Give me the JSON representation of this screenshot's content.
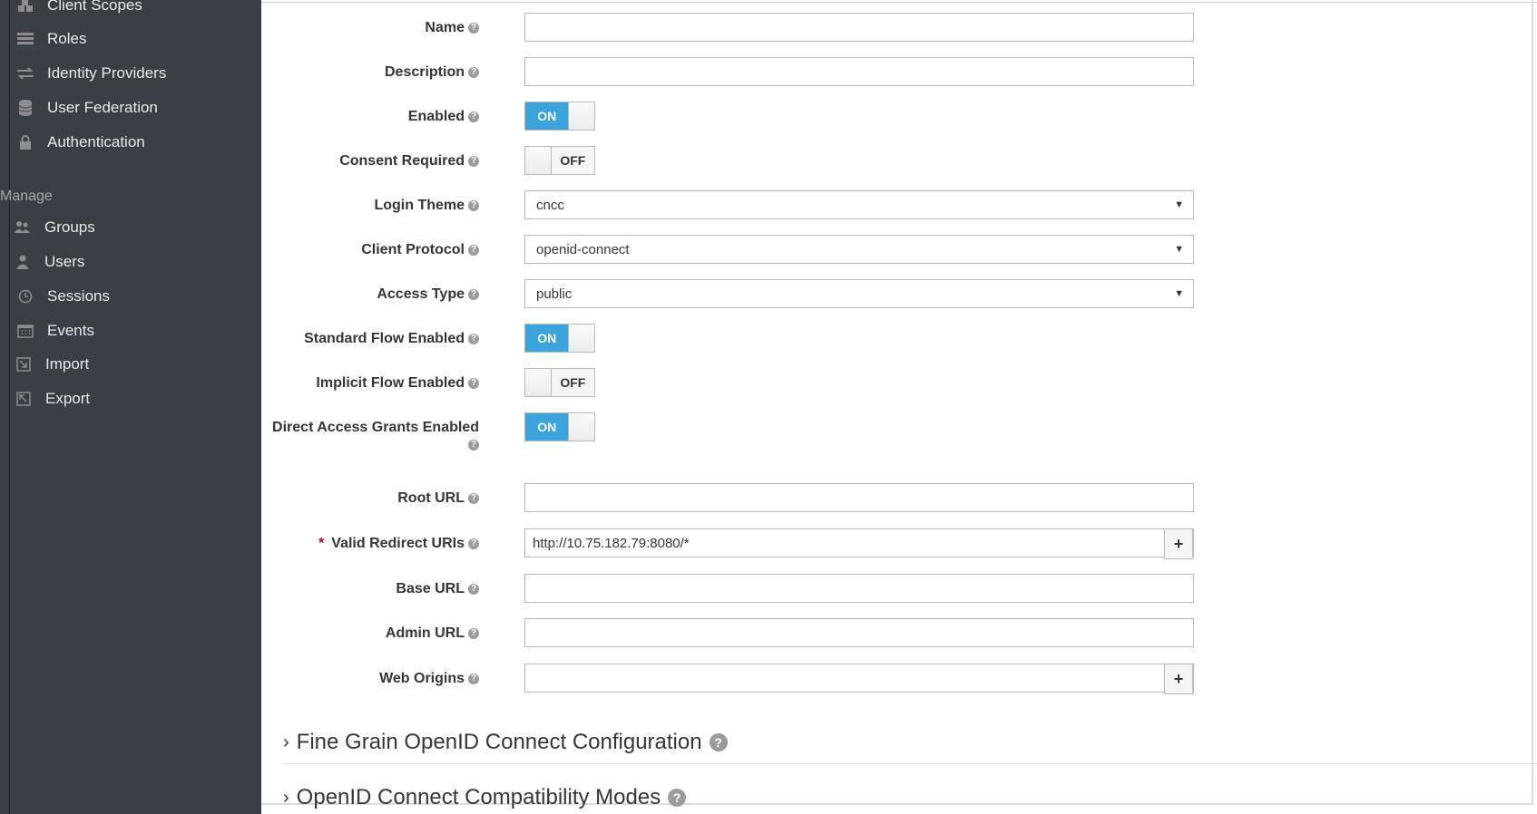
{
  "sidebar": {
    "top_items": [
      {
        "label": "Client Scopes",
        "icon": "cubes-icon"
      },
      {
        "label": "Roles",
        "icon": "roles-list-icon"
      },
      {
        "label": "Identity Providers",
        "icon": "exchange-icon"
      },
      {
        "label": "User Federation",
        "icon": "database-icon"
      },
      {
        "label": "Authentication",
        "icon": "lock-icon"
      }
    ],
    "section": "Manage",
    "manage_items": [
      {
        "label": "Groups",
        "icon": "users-icon"
      },
      {
        "label": "Users",
        "icon": "user-icon"
      },
      {
        "label": "Sessions",
        "icon": "clock-icon"
      },
      {
        "label": "Events",
        "icon": "calendar-icon"
      },
      {
        "label": "Import",
        "icon": "import-icon"
      },
      {
        "label": "Export",
        "icon": "export-icon"
      }
    ]
  },
  "form": {
    "name": {
      "label": "Name",
      "value": ""
    },
    "description": {
      "label": "Description",
      "value": ""
    },
    "enabled": {
      "label": "Enabled",
      "state": "ON"
    },
    "consent_required": {
      "label": "Consent Required",
      "state": "OFF"
    },
    "login_theme": {
      "label": "Login Theme",
      "value": "cncc"
    },
    "client_protocol": {
      "label": "Client Protocol",
      "value": "openid-connect"
    },
    "access_type": {
      "label": "Access Type",
      "value": "public"
    },
    "standard_flow": {
      "label": "Standard Flow Enabled",
      "state": "ON"
    },
    "implicit_flow": {
      "label": "Implicit Flow Enabled",
      "state": "OFF"
    },
    "direct_access": {
      "label": "Direct Access Grants Enabled",
      "state": "ON"
    },
    "root_url": {
      "label": "Root URL",
      "value": ""
    },
    "valid_redirect": {
      "label": "Valid Redirect URIs",
      "required_mark": "*",
      "value": "http://10.75.182.79:8080/*"
    },
    "base_url": {
      "label": "Base URL",
      "value": ""
    },
    "admin_url": {
      "label": "Admin URL",
      "value": ""
    },
    "web_origins": {
      "label": "Web Origins",
      "value": ""
    },
    "plus": "+",
    "help": "?"
  },
  "sections": {
    "fine_grain": "Fine Grain OpenID Connect Configuration",
    "compat": "OpenID Connect Compatibility Modes",
    "chevron": "›"
  },
  "colors": {
    "sidebar_bg": "#393f44",
    "toggle_on": "#39a5dc"
  }
}
